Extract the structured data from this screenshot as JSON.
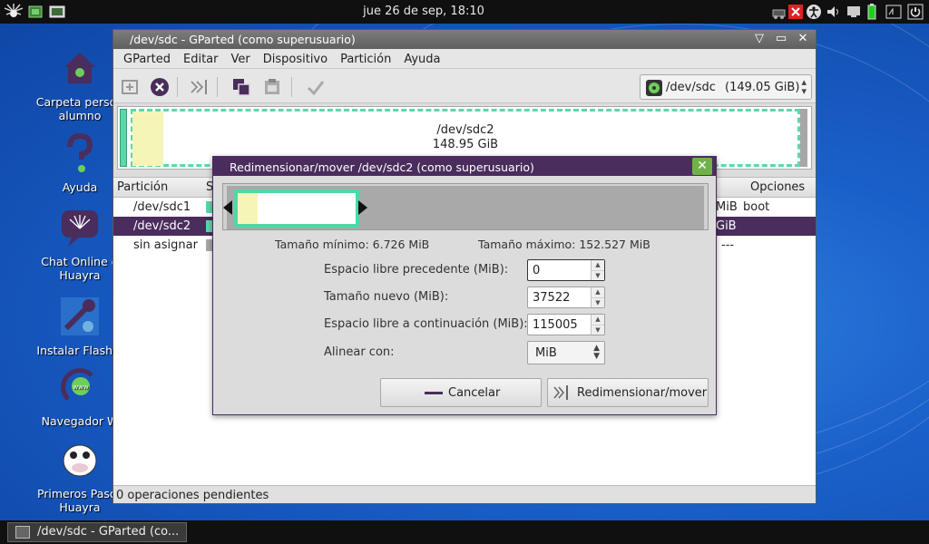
{
  "top_panel": {
    "clock": "jue 26 de sep, 18:10"
  },
  "desktop": {
    "icons": [
      {
        "label": "Carpeta personal de alumno",
        "line1": "Carpeta person",
        "line2": "alumno",
        "icon": "home-folder-icon"
      },
      {
        "label": "Ayuda",
        "line1": "Ayuda",
        "icon": "help-icon"
      },
      {
        "label": "Chat Online de Huayra",
        "line1": "Chat Online d",
        "line2": "Huayra",
        "icon": "chat-icon"
      },
      {
        "label": "Instalar Flash Player",
        "line1": "Instalar Flash P",
        "icon": "tools-icon"
      },
      {
        "label": "Navegador Web",
        "line1": "Navegador W",
        "icon": "browser-icon"
      },
      {
        "label": "Primeros Pasos Huayra",
        "line1": "Primeros Pasos",
        "line2": "Huayra",
        "icon": "cow-icon"
      }
    ]
  },
  "main_window": {
    "title": "/dev/sdc - GParted (como superusuario)",
    "menu": [
      "GParted",
      "Editar",
      "Ver",
      "Dispositivo",
      "Partición",
      "Ayuda"
    ],
    "device_selector": {
      "device": "/dev/sdc",
      "size": "(149.05 GiB)"
    },
    "partition_visual": {
      "name": "/dev/sdc2",
      "size": "148.95 GiB"
    },
    "table": {
      "headers": {
        "partition": "Partición",
        "s": "S",
        "options": "Opciones"
      },
      "rows": [
        {
          "partition": "/dev/sdc1",
          "size_tail": "MiB",
          "options": "boot",
          "color": "#5bd8a8"
        },
        {
          "partition": "/dev/sdc2",
          "size_tail": "GiB",
          "options": "",
          "color": "#5bd8a8",
          "selected": true
        },
        {
          "partition": "sin asignar",
          "size_tail": "",
          "options": "---",
          "color": "#a7a7a7"
        }
      ]
    },
    "status": "0 operaciones pendientes"
  },
  "dialog": {
    "title": "Redimensionar/mover /dev/sdc2 (como superusuario)",
    "min_size": "Tamaño mínimo: 6.726 MiB",
    "max_size": "Tamaño máximo: 152.527 MiB",
    "fields": {
      "free_before_label": "Espacio libre precedente (MiB):",
      "free_before_value": "0",
      "new_size_label": "Tamaño nuevo (MiB):",
      "new_size_value": "37522",
      "free_after_label": "Espacio libre a continuación (MiB):",
      "free_after_value": "115005",
      "align_label": "Alinear con:",
      "align_value": "MiB"
    },
    "buttons": {
      "cancel": "Cancelar",
      "resize": "Redimensionar/mover"
    }
  },
  "taskbar": {
    "item": "/dev/sdc - GParted (co..."
  },
  "colors": {
    "accent": "#4a2d5c",
    "partition_ext4": "#5bd8a8",
    "used_space": "#f6f5b8",
    "unallocated": "#a7a7a7",
    "close_green": "#6fb24a"
  }
}
